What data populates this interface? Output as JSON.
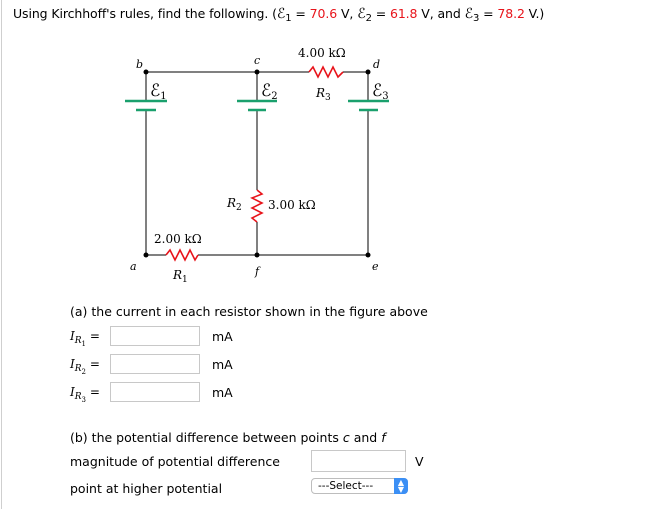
{
  "question": {
    "prefix": "Using Kirchhoff's rules, find the following. (",
    "emf1_symbol": "ℰ",
    "emf1_sub": "1",
    "emf1_eq": " = ",
    "emf1_value": "70.6",
    "emf1_unit": " V, ",
    "emf2_symbol": "ℰ",
    "emf2_sub": "2",
    "emf2_eq": " = ",
    "emf2_value": "61.8",
    "emf2_unit": " V, and ",
    "emf3_symbol": "ℰ",
    "emf3_sub": "3",
    "emf3_eq": " = ",
    "emf3_value": "78.2",
    "emf3_unit": " V.)",
    "highlight_color": "#e8141b"
  },
  "circuit": {
    "nodes": {
      "a": "a",
      "b": "b",
      "c": "c",
      "d": "d",
      "e": "e",
      "f": "f"
    },
    "batteries": [
      {
        "symbol": "ℰ",
        "sub": "1"
      },
      {
        "symbol": "ℰ",
        "sub": "2"
      },
      {
        "symbol": "ℰ",
        "sub": "3"
      }
    ],
    "resistors": [
      {
        "name": "R",
        "sub": "1",
        "value": "2.00 kΩ"
      },
      {
        "name": "R",
        "sub": "2",
        "value": "3.00 kΩ"
      },
      {
        "name": "R",
        "sub": "3",
        "value": "4.00 kΩ"
      }
    ],
    "battery_color": "#1aa06d",
    "resistor_color": "#e8141b"
  },
  "part_a": {
    "title": "(a) the current in each resistor shown in the figure above",
    "rows": [
      {
        "label_i": "I",
        "label_r": "R",
        "label_sub": "1",
        "eq": " =",
        "value": "",
        "unit": "mA"
      },
      {
        "label_i": "I",
        "label_r": "R",
        "label_sub": "2",
        "eq": " =",
        "value": "",
        "unit": "mA"
      },
      {
        "label_i": "I",
        "label_r": "R",
        "label_sub": "3",
        "eq": " =",
        "value": "",
        "unit": "mA"
      }
    ]
  },
  "part_b": {
    "title_prefix": "(b) the potential difference between points ",
    "point1": "c",
    "title_and": " and ",
    "point2": "f",
    "magnitude_label": "magnitude of potential difference",
    "magnitude_value": "",
    "magnitude_unit": "V",
    "higher_label": "point at higher potential",
    "select_value": "---Select---"
  }
}
